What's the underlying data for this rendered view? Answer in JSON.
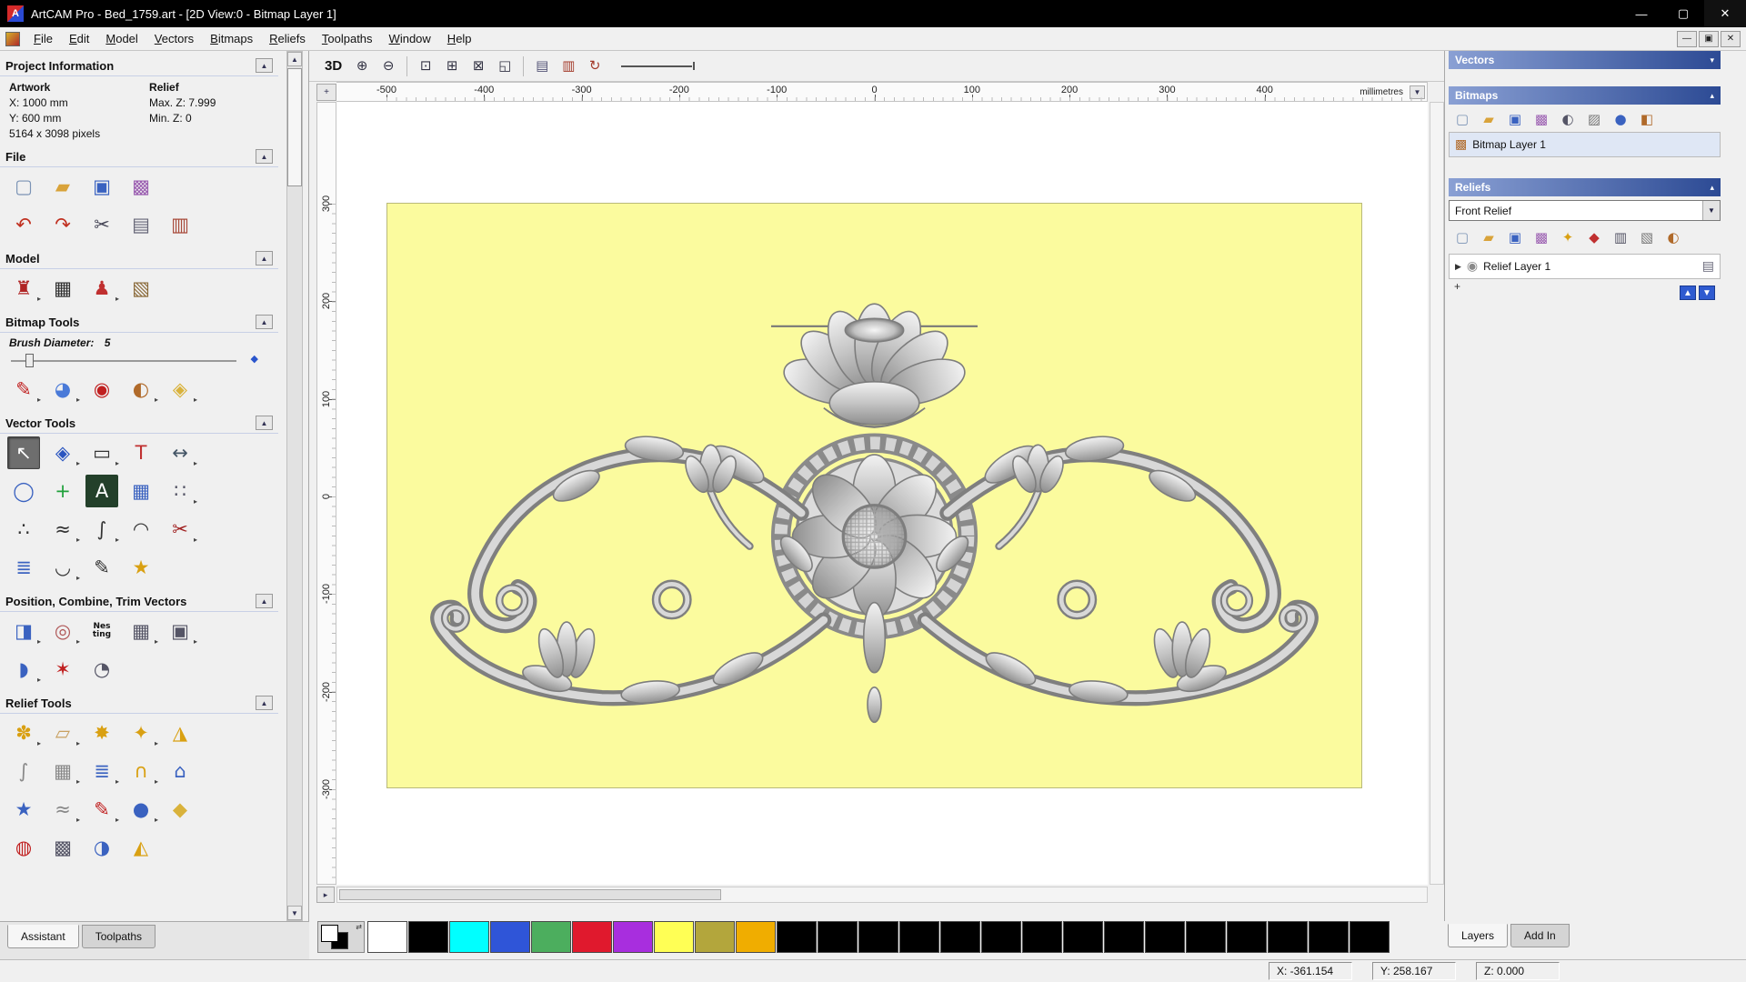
{
  "window": {
    "title": "ArtCAM Pro - Bed_1759.art - [2D View:0 - Bitmap Layer 1]",
    "logo": "A",
    "controls": {
      "minimize": "—",
      "maximize": "▢",
      "close": "✕"
    }
  },
  "menu": {
    "items": [
      "File",
      "Edit",
      "Model",
      "Vectors",
      "Bitmaps",
      "Reliefs",
      "Toolpaths",
      "Window",
      "Help"
    ],
    "mdi_controls": {
      "minimize": "—",
      "restore": "▣",
      "close": "✕"
    }
  },
  "assistant": {
    "tabs": [
      "Assistant",
      "Toolpaths"
    ],
    "project_info": {
      "title": "Project Information",
      "artwork": "Artwork",
      "relief": "Relief",
      "x": "X: 1000 mm",
      "y": "Y: 600 mm",
      "max_z": "Max. Z: 7.999",
      "min_z": "Min. Z: 0",
      "pixels": "5164 x 3098 pixels"
    },
    "file": {
      "title": "File",
      "row1": [
        {
          "name": "new-model-button",
          "glyph": "▢",
          "color": "#7b93b5"
        },
        {
          "name": "open-model-button",
          "glyph": "▰",
          "color": "#d9a33a"
        },
        {
          "name": "save-model-button",
          "glyph": "▣",
          "color": "#3a62c0"
        },
        {
          "name": "import-image-button",
          "glyph": "▩",
          "color": "#9a5db0"
        }
      ],
      "row2": [
        {
          "name": "undo-button",
          "glyph": "↶",
          "color": "#c03020"
        },
        {
          "name": "redo-button",
          "glyph": "↷",
          "color": "#c03020"
        },
        {
          "name": "cut-button",
          "glyph": "✂",
          "color": "#444455"
        },
        {
          "name": "copy-button",
          "glyph": "▤",
          "color": "#666677"
        },
        {
          "name": "paste-button",
          "glyph": "▥",
          "color": "#a84a3a"
        }
      ]
    },
    "model": {
      "title": "Model",
      "row": [
        {
          "name": "adjust-model-button",
          "glyph": "♜",
          "color": "#b02525",
          "menu": true
        },
        {
          "name": "light-material-button",
          "glyph": "▦",
          "color": "#303030"
        },
        {
          "name": "model-notes-button",
          "glyph": "♟",
          "color": "#c03030",
          "menu": true
        },
        {
          "name": "model-preview-button",
          "glyph": "▧",
          "color": "#8a6a3a"
        }
      ]
    },
    "bitmap_tools": {
      "title": "Bitmap Tools",
      "brush_label": "Brush Diameter:",
      "brush_value": "5",
      "row": [
        {
          "name": "paint-button",
          "glyph": "✎",
          "color": "#c02020",
          "menu": true
        },
        {
          "name": "paint-selective-button",
          "glyph": "◕",
          "color": "#4a7ad8",
          "menu": true
        },
        {
          "name": "flood-fill-button",
          "glyph": "◉",
          "color": "#c02020"
        },
        {
          "name": "colour-editor-button",
          "glyph": "◐",
          "color": "#b06a2a",
          "menu": true
        },
        {
          "name": "texture-fill-button",
          "glyph": "◈",
          "color": "#d9b23b",
          "menu": true
        }
      ]
    },
    "vector_tools": {
      "title": "Vector Tools",
      "rows": [
        [
          {
            "name": "select-vectors-button",
            "glyph": "↖",
            "color": "#ffffff",
            "pressed": true
          },
          {
            "name": "transform-vectors-button",
            "glyph": "◈",
            "color": "#2a55c0",
            "menu": true
          },
          {
            "name": "create-rectangle-button",
            "glyph": "▭",
            "color": "#333333",
            "menu": true
          },
          {
            "name": "create-text-button",
            "glyph": "T",
            "color": "#c03030"
          },
          {
            "name": "measure-button",
            "glyph": "↔",
            "color": "#445566",
            "menu": true
          }
        ],
        [
          {
            "name": "create-ellipse-button",
            "glyph": "◯",
            "color": "#3a62c0"
          },
          {
            "name": "create-polyline-button",
            "glyph": "+",
            "color": "#1fa03a"
          },
          {
            "name": "bitmap-to-vector-button",
            "glyph": "A",
            "color": "#ffffff",
            "bg": "#23402a"
          },
          {
            "name": "snap-grid-button",
            "glyph": "▦",
            "color": "#3a62c0"
          },
          {
            "name": "block-array-button",
            "glyph": "∷",
            "color": "#555566",
            "menu": true
          }
        ],
        [
          {
            "name": "node-editing-button",
            "glyph": "∴",
            "color": "#333333"
          },
          {
            "name": "smooth-polyline-button",
            "glyph": "≈",
            "color": "#333333",
            "menu": true
          },
          {
            "name": "fit-curve-button",
            "glyph": "∫",
            "color": "#333333",
            "menu": true
          },
          {
            "name": "create-arc-button",
            "glyph": "◠",
            "color": "#333333"
          },
          {
            "name": "trim-vectors-button",
            "glyph": "✂",
            "color": "#a02020",
            "menu": true
          }
        ],
        [
          {
            "name": "offset-vectors-button",
            "glyph": "≣",
            "color": "#3a62c0"
          },
          {
            "name": "fit-arcs-button",
            "glyph": "◡",
            "color": "#333333",
            "menu": true
          },
          {
            "name": "free-draw-button",
            "glyph": "✎",
            "color": "#333333"
          },
          {
            "name": "create-star-button",
            "glyph": "★",
            "color": "#d9a012"
          }
        ]
      ]
    },
    "position_tools": {
      "title": "Position, Combine, Trim Vectors",
      "rows": [
        [
          {
            "name": "align-objects-button",
            "glyph": "◨",
            "color": "#3a62c0",
            "menu": true
          },
          {
            "name": "circular-copy-button",
            "glyph": "◎",
            "color": "#b05858",
            "menu": true
          },
          {
            "name": "nesting-button",
            "glyph": "Nes\nting",
            "color": "#111111",
            "small": true
          },
          {
            "name": "block-copy-button",
            "glyph": "▦",
            "color": "#555566",
            "menu": true
          },
          {
            "name": "group-merge-button",
            "glyph": "▣",
            "color": "#555566",
            "menu": true
          }
        ],
        [
          {
            "name": "mirror-vectors-button",
            "glyph": "◗",
            "color": "#3a62c0",
            "menu": true
          },
          {
            "name": "weld-vectors-button",
            "glyph": "✶",
            "color": "#c02020"
          },
          {
            "name": "spiral-button",
            "glyph": "◔",
            "color": "#555566"
          }
        ]
      ]
    },
    "relief_tools": {
      "title": "Relief Tools",
      "rows": [
        [
          {
            "name": "shape-editor-button",
            "glyph": "✽",
            "color": "#d9a012",
            "menu": true
          },
          {
            "name": "smooth-relief-button",
            "glyph": "▱",
            "color": "#c8a060",
            "menu": true
          },
          {
            "name": "sculpt-button",
            "glyph": "✸",
            "color": "#d9a012"
          },
          {
            "name": "add-clipart-button",
            "glyph": "✦",
            "color": "#d9a012",
            "menu": true
          },
          {
            "name": "mirror-relief-button",
            "glyph": "◮",
            "color": "#d9a012"
          }
        ],
        [
          {
            "name": "smoothing-button",
            "glyph": "∫",
            "color": "#888888"
          },
          {
            "name": "texture-weave-button",
            "glyph": "▦",
            "color": "#888888",
            "menu": true
          },
          {
            "name": "offset-relief-button",
            "glyph": "≣",
            "color": "#3a62c0",
            "menu": true
          },
          {
            "name": "dome-button",
            "glyph": "∩",
            "color": "#d9a012",
            "menu": true
          },
          {
            "name": "envelope-button",
            "glyph": "⌂",
            "color": "#3a62c0"
          }
        ],
        [
          {
            "name": "star-wizard-button",
            "glyph": "★",
            "color": "#3a62c0"
          },
          {
            "name": "wave-wizard-button",
            "glyph": "≈",
            "color": "#888888",
            "menu": true
          },
          {
            "name": "paint-relief-button",
            "glyph": "✎",
            "color": "#c02020",
            "menu": true
          },
          {
            "name": "texture-sphere-button",
            "glyph": "●",
            "color": "#3a62c0",
            "menu": true
          },
          {
            "name": "extrude-button",
            "glyph": "◆",
            "color": "#d9b23b"
          }
        ],
        [
          {
            "name": "turn-model-button",
            "glyph": "◍",
            "color": "#c02020"
          },
          {
            "name": "mesh-creator-button",
            "glyph": "▩",
            "color": "#555566"
          },
          {
            "name": "face-wizard-button",
            "glyph": "◑",
            "color": "#3a62c0"
          },
          {
            "name": "emboss-button",
            "glyph": "◭",
            "color": "#d9a012"
          }
        ]
      ]
    }
  },
  "canvas": {
    "toolbar": {
      "view3d": "3D",
      "icons1": [
        {
          "name": "zoom-in-button",
          "glyph": "⊕",
          "color": "#333344"
        },
        {
          "name": "zoom-out-button",
          "glyph": "⊖",
          "color": "#333344"
        }
      ],
      "icons2": [
        {
          "name": "zoom-window-button",
          "glyph": "⊡",
          "color": "#333344"
        },
        {
          "name": "zoom-1to1-button",
          "glyph": "⊞",
          "color": "#333344"
        },
        {
          "name": "zoom-fit-button",
          "glyph": "⊠",
          "color": "#333344"
        },
        {
          "name": "zoom-object-button",
          "glyph": "◱",
          "color": "#333344"
        }
      ],
      "icons3": [
        {
          "name": "copy-view-button",
          "glyph": "▤",
          "color": "#555577"
        },
        {
          "name": "paste-view-button",
          "glyph": "▥",
          "color": "#a33a2a"
        },
        {
          "name": "refresh-view-button",
          "glyph": "↻",
          "color": "#a33a2a"
        }
      ]
    },
    "ruler": {
      "units": "millimetres",
      "h": [
        "-500",
        "-400",
        "-300",
        "-200",
        "-100",
        "0",
        "100",
        "200",
        "300",
        "400"
      ],
      "v": [
        "300",
        "200",
        "100",
        "0",
        "-100",
        "-200",
        "-300"
      ]
    }
  },
  "panels": {
    "vectors": {
      "title": "Vectors"
    },
    "bitmaps": {
      "title": "Bitmaps",
      "icons": [
        {
          "name": "new-bitmap-button",
          "glyph": "▢",
          "color": "#7b93b5"
        },
        {
          "name": "open-bitmap-button",
          "glyph": "▰",
          "color": "#d9a33a"
        },
        {
          "name": "save-bitmap-button",
          "glyph": "▣",
          "color": "#3a62c0"
        },
        {
          "name": "import-bitmap-button",
          "glyph": "▩",
          "color": "#9a5db0"
        },
        {
          "name": "bitmap-contrast-button",
          "glyph": "◐",
          "color": "#555566"
        },
        {
          "name": "bitmap-greyscale-button",
          "glyph": "▨",
          "color": "#777777"
        },
        {
          "name": "colour-reduce-button",
          "glyph": "●",
          "color": "#3a62c0"
        },
        {
          "name": "bitmap-options-button",
          "glyph": "◧",
          "color": "#b06a2a"
        }
      ],
      "layer": "Bitmap Layer 1"
    },
    "reliefs": {
      "title": "Reliefs",
      "selected": "Front Relief",
      "icons": [
        {
          "name": "new-relief-button",
          "glyph": "▢",
          "color": "#7b93b5"
        },
        {
          "name": "open-relief-button",
          "glyph": "▰",
          "color": "#d9a33a"
        },
        {
          "name": "save-relief-button",
          "glyph": "▣",
          "color": "#3a62c0"
        },
        {
          "name": "import-relief-button",
          "glyph": "▩",
          "color": "#9a5db0"
        },
        {
          "name": "smooth-relief-panel-button",
          "glyph": "✦",
          "color": "#d9a012"
        },
        {
          "name": "calculate-relief-button",
          "glyph": "◆",
          "color": "#c03030"
        },
        {
          "name": "relief-preview-button",
          "glyph": "▥",
          "color": "#555566"
        },
        {
          "name": "relief-greyscale-button",
          "glyph": "▧",
          "color": "#777777"
        },
        {
          "name": "relief-options-button",
          "glyph": "◐",
          "color": "#b06a2a"
        }
      ],
      "layer": "Relief Layer 1"
    },
    "tabs": [
      "Layers",
      "Add In"
    ]
  },
  "palette": {
    "colors": [
      "#ffffff",
      "#000000",
      "#00ffff",
      "#2f55d8",
      "#4cae5e",
      "#e0192d",
      "#a82ede",
      "#ffff55",
      "#b3a63c",
      "#f0ad00",
      "#000000",
      "#000000",
      "#000000",
      "#000000",
      "#000000",
      "#000000",
      "#000000",
      "#000000",
      "#000000",
      "#000000",
      "#000000",
      "#000000",
      "#000000",
      "#000000",
      "#000000"
    ]
  },
  "status": {
    "x": "X: -361.154",
    "y": "Y: 258.167",
    "z": "Z: 0.000"
  }
}
